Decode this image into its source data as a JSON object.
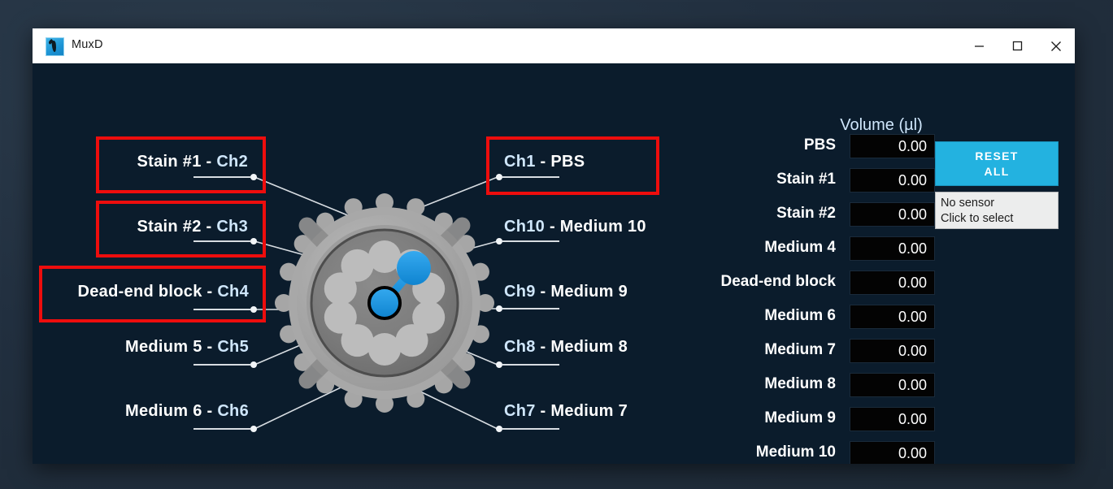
{
  "window": {
    "title": "MuxD",
    "icon": "app-icon",
    "controls": {
      "minimize": "minimize-icon",
      "maximize": "maximize-icon",
      "close": "close-icon"
    }
  },
  "colors": {
    "app_background": "#0b1c2c",
    "titlebar": "#ffffff",
    "accent_cyan": "#23b2e0",
    "highlight_red": "#ee0d0d",
    "channel_label": "#cfe6fb",
    "field_background": "#030303",
    "valve_body": "#9b9b9b",
    "selector_blue": "#1e9ce6"
  },
  "diagram": {
    "title": "valve-channel-map",
    "channels": [
      {
        "id": "ch1",
        "channel": "Ch1",
        "name": "PBS",
        "side": "right",
        "order": "channel-first",
        "highlighted": true
      },
      {
        "id": "ch2",
        "channel": "Ch2",
        "name": "Stain #1",
        "side": "left",
        "order": "name-first",
        "highlighted": true
      },
      {
        "id": "ch3",
        "channel": "Ch3",
        "name": "Stain #2",
        "side": "left",
        "order": "name-first",
        "highlighted": true
      },
      {
        "id": "ch4",
        "channel": "Ch4",
        "name": "Dead-end block",
        "side": "left",
        "order": "name-first",
        "highlighted": true
      },
      {
        "id": "ch5",
        "channel": "Ch5",
        "name": "Medium 5",
        "side": "left",
        "order": "name-first",
        "highlighted": false
      },
      {
        "id": "ch6",
        "channel": "Ch6",
        "name": "Medium 6",
        "side": "left",
        "order": "name-first",
        "highlighted": false
      },
      {
        "id": "ch7",
        "channel": "Ch7",
        "name": "Medium 7",
        "side": "right",
        "order": "channel-first",
        "highlighted": false
      },
      {
        "id": "ch8",
        "channel": "Ch8",
        "name": "Medium 8",
        "side": "right",
        "order": "channel-first",
        "highlighted": false
      },
      {
        "id": "ch9",
        "channel": "Ch9",
        "name": "Medium 9",
        "side": "right",
        "order": "channel-first",
        "highlighted": false
      },
      {
        "id": "ch10",
        "channel": "Ch10",
        "name": "Medium 10",
        "side": "right",
        "order": "channel-first",
        "highlighted": false
      }
    ],
    "separator": "-",
    "selected_channel": "Ch1"
  },
  "panel": {
    "volume_header": "Volume (µl)",
    "rows": [
      {
        "label": "PBS",
        "value": "0.00"
      },
      {
        "label": "Stain #1",
        "value": "0.00"
      },
      {
        "label": "Stain #2",
        "value": "0.00"
      },
      {
        "label": "Medium 4",
        "value": "0.00"
      },
      {
        "label": "Dead-end block",
        "value": "0.00"
      },
      {
        "label": "Medium 6",
        "value": "0.00"
      },
      {
        "label": "Medium 7",
        "value": "0.00"
      },
      {
        "label": "Medium 8",
        "value": "0.00"
      },
      {
        "label": "Medium 9",
        "value": "0.00"
      },
      {
        "label": "Medium 10",
        "value": "0.00"
      }
    ],
    "reset_button": {
      "line1": "RESET",
      "line2": "ALL"
    },
    "sensor_box": {
      "line1": "No sensor",
      "line2": "Click to select"
    }
  }
}
